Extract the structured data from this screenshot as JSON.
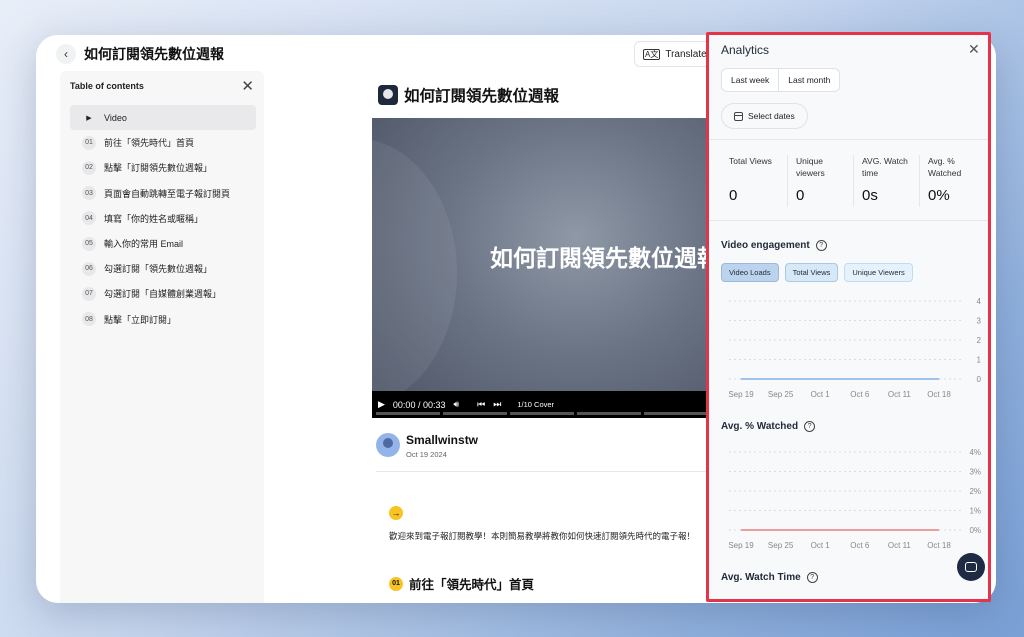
{
  "header": {
    "title": "如何訂閱領先數位週報",
    "translate_label": "Translate this"
  },
  "toc": {
    "title": "Table of contents",
    "items": [
      {
        "num": "",
        "label": "Video"
      },
      {
        "num": "01",
        "label": "前往「領先時代」首頁"
      },
      {
        "num": "02",
        "label": "點擊「訂閱領先數位週報」"
      },
      {
        "num": "03",
        "label": "頁面會自動跳轉至電子報訂閱頁"
      },
      {
        "num": "04",
        "label": "填寫「你的姓名或暱稱」"
      },
      {
        "num": "05",
        "label": "輸入你的常用 Email"
      },
      {
        "num": "06",
        "label": "勾選訂閱「領先數位週報」"
      },
      {
        "num": "07",
        "label": "勾選訂閱「自媒體創業週報」"
      },
      {
        "num": "08",
        "label": "點擊「立即訂閱」"
      }
    ]
  },
  "main": {
    "title": "如何訂閱領先數位週報",
    "video_text": "如何訂閱領先數位週報",
    "time": "00:00 / 00:33",
    "chapter": "1/10 Cover",
    "author": "Smallwinstw",
    "date": "Oct 19 2024",
    "intro": "歡迎來到電子報訂閱教學！本則簡易教學將教你如何快速訂閱領先時代的電子報！",
    "section_num": "01",
    "section_title": "前往「領先時代」首頁"
  },
  "analytics": {
    "title": "Analytics",
    "last_week": "Last week",
    "last_month": "Last month",
    "select_dates": "Select dates",
    "stats": [
      {
        "label": "Total Views",
        "value": "0"
      },
      {
        "label": "Unique viewers",
        "value": "0"
      },
      {
        "label": "AVG. Watch time",
        "value": "0s"
      },
      {
        "label": "Avg. % Watched",
        "value": "0%"
      }
    ],
    "engagement_title": "Video engagement",
    "pills": [
      "Video Loads",
      "Total Views",
      "Unique Viewers"
    ],
    "watched_title": "Avg. % Watched",
    "watch_time_title": "Avg. Watch Time"
  },
  "chart_data": [
    {
      "type": "line",
      "x": [
        "Sep 19",
        "Sep 25",
        "Oct 1",
        "Oct 6",
        "Oct 11",
        "Oct 18"
      ],
      "ylim": [
        0,
        4
      ],
      "yticks": [
        "0",
        "1",
        "2",
        "3",
        "4"
      ],
      "series": [
        {
          "values": [
            0,
            0,
            0,
            0,
            0,
            0
          ],
          "color": "#7fb2e5"
        }
      ],
      "grid": true
    },
    {
      "type": "line",
      "x": [
        "Sep 19",
        "Sep 25",
        "Oct 1",
        "Oct 6",
        "Oct 11",
        "Oct 18"
      ],
      "ylim": [
        0,
        4
      ],
      "yticks": [
        "0%",
        "1%",
        "2%",
        "3%",
        "4%"
      ],
      "series": [
        {
          "values": [
            0,
            0,
            0,
            0,
            0,
            0
          ],
          "color": "#e88080"
        }
      ],
      "grid": true
    }
  ]
}
